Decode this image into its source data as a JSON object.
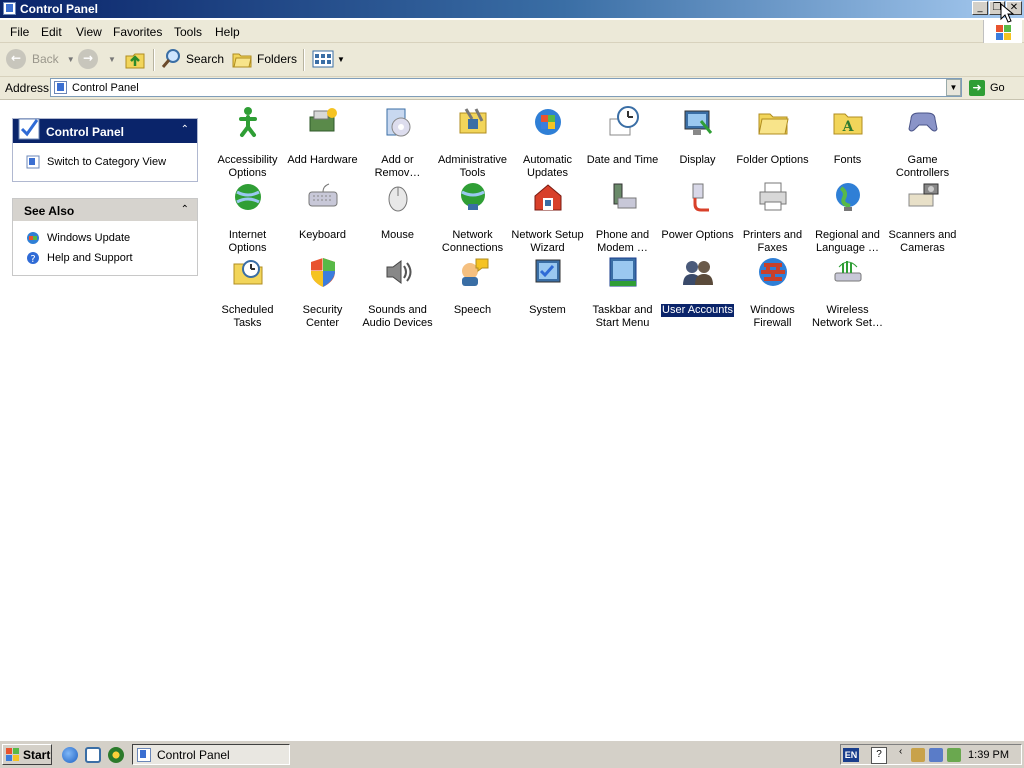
{
  "window": {
    "title": "Control Panel"
  },
  "title_buttons": {
    "minimize": "_",
    "restore": "❐",
    "close": "✕"
  },
  "menu": [
    "File",
    "Edit",
    "View",
    "Favorites",
    "Tools",
    "Help"
  ],
  "toolbar": {
    "back": "Back",
    "search": "Search",
    "folders": "Folders"
  },
  "address": {
    "label": "Address",
    "value": "Control Panel",
    "go": "Go"
  },
  "left_pane": {
    "control_panel": {
      "title": "Control Panel",
      "link": "Switch to Category View"
    },
    "see_also": {
      "title": "See Also",
      "links": [
        "Windows Update",
        "Help and Support"
      ]
    }
  },
  "icons": [
    {
      "label": "Accessibility\nOptions",
      "icon": "accessibility-icon"
    },
    {
      "label": "Add Hardware",
      "icon": "add-hardware-icon"
    },
    {
      "label": "Add or\nRemov…",
      "icon": "add-remove-programs-icon"
    },
    {
      "label": "Administrative\nTools",
      "icon": "administrative-tools-icon"
    },
    {
      "label": "Automatic\nUpdates",
      "icon": "automatic-updates-icon"
    },
    {
      "label": "Date and Time",
      "icon": "date-time-icon"
    },
    {
      "label": "Display",
      "icon": "display-icon"
    },
    {
      "label": "Folder Options",
      "icon": "folder-options-icon"
    },
    {
      "label": "Fonts",
      "icon": "fonts-icon"
    },
    {
      "label": "Game\nControllers",
      "icon": "game-controllers-icon"
    },
    {
      "label": "Internet\nOptions",
      "icon": "internet-options-icon"
    },
    {
      "label": "Keyboard",
      "icon": "keyboard-icon"
    },
    {
      "label": "Mouse",
      "icon": "mouse-icon"
    },
    {
      "label": "Network\nConnections",
      "icon": "network-connections-icon"
    },
    {
      "label": "Network Setup\nWizard",
      "icon": "network-setup-icon"
    },
    {
      "label": "Phone and\nModem …",
      "icon": "phone-modem-icon"
    },
    {
      "label": "Power Options",
      "icon": "power-options-icon"
    },
    {
      "label": "Printers and\nFaxes",
      "icon": "printers-icon"
    },
    {
      "label": "Regional and\nLanguage …",
      "icon": "regional-icon"
    },
    {
      "label": "Scanners and\nCameras",
      "icon": "scanners-icon"
    },
    {
      "label": "Scheduled\nTasks",
      "icon": "scheduled-tasks-icon"
    },
    {
      "label": "Security\nCenter",
      "icon": "security-center-icon"
    },
    {
      "label": "Sounds and\nAudio Devices",
      "icon": "sounds-icon"
    },
    {
      "label": "Speech",
      "icon": "speech-icon"
    },
    {
      "label": "System",
      "icon": "system-icon"
    },
    {
      "label": "Taskbar and\nStart Menu",
      "icon": "taskbar-icon"
    },
    {
      "label": "User Accounts",
      "icon": "user-accounts-icon",
      "selected": true
    },
    {
      "label": "Windows\nFirewall",
      "icon": "firewall-icon"
    },
    {
      "label": "Wireless\nNetwork Set…",
      "icon": "wireless-icon"
    }
  ],
  "taskbar": {
    "start": "Start",
    "task": "Control Panel",
    "lang": "EN",
    "clock": "1:39 PM"
  }
}
